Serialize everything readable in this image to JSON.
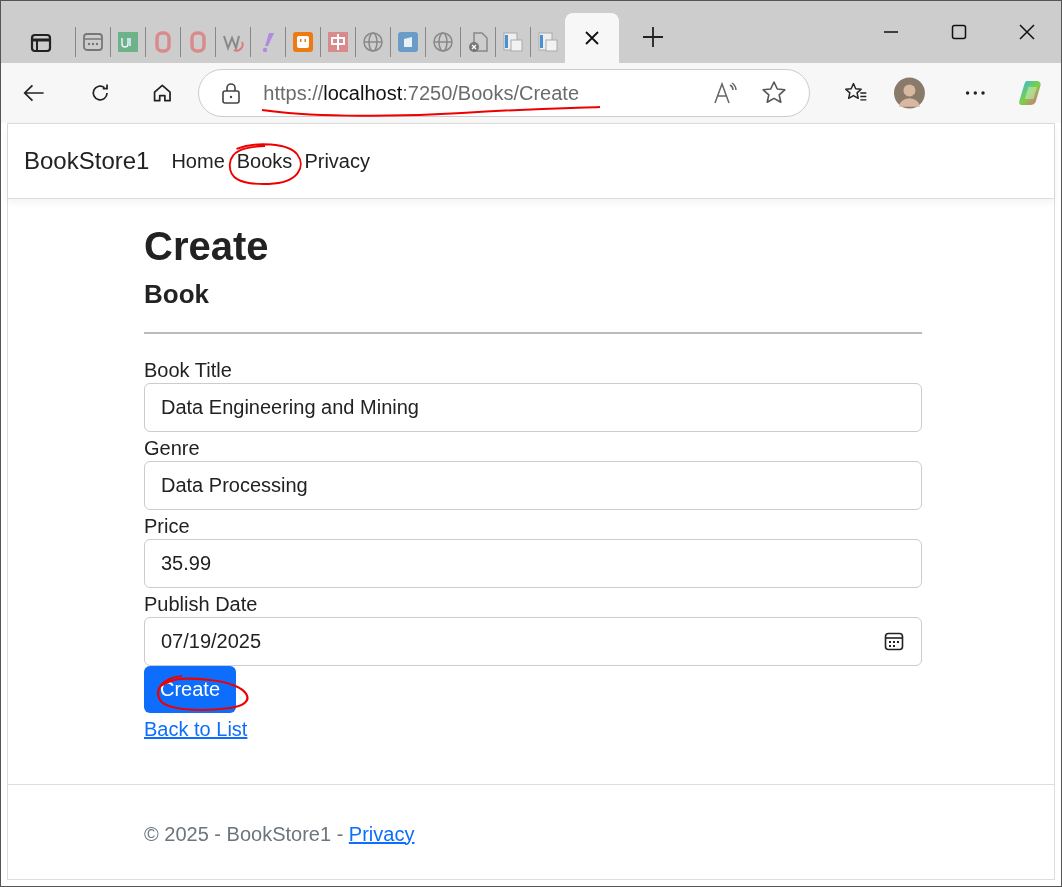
{
  "browser": {
    "tabs": [
      {
        "kind": "calendar",
        "selected": false
      },
      {
        "kind": "green",
        "selected": false
      },
      {
        "kind": "ring",
        "selected": false
      },
      {
        "kind": "ring",
        "selected": false
      },
      {
        "kind": "wave",
        "selected": false
      },
      {
        "kind": "exclaim",
        "selected": false
      },
      {
        "kind": "plug",
        "selected": false
      },
      {
        "kind": "redsquare",
        "selected": false
      },
      {
        "kind": "globe",
        "selected": false
      },
      {
        "kind": "bluedoc",
        "selected": false
      },
      {
        "kind": "globe",
        "selected": false
      },
      {
        "kind": "fileerror",
        "selected": false
      },
      {
        "kind": "pages",
        "selected": false
      },
      {
        "kind": "pages",
        "selected": false
      },
      {
        "kind": "blank",
        "selected": true
      }
    ],
    "address": {
      "scheme": "https://",
      "host": "localhost",
      "rest": ":7250/Books/Create"
    }
  },
  "navbar": {
    "brand": "BookStore1",
    "links": [
      {
        "label": "Home",
        "circled": false
      },
      {
        "label": "Books",
        "circled": true
      },
      {
        "label": "Privacy",
        "circled": false
      }
    ]
  },
  "page": {
    "title": "Create",
    "subtitle": "Book",
    "fields": [
      {
        "label": "Book Title",
        "value": "Data Engineering and Mining",
        "kind": "text"
      },
      {
        "label": "Genre",
        "value": "Data Processing",
        "kind": "text"
      },
      {
        "label": "Price",
        "value": "35.99",
        "kind": "text"
      },
      {
        "label": "Publish Date",
        "value": "07/19/2025",
        "kind": "date"
      }
    ],
    "submit": {
      "label": "Create",
      "circled": true
    },
    "back_link": "Back to List"
  },
  "footer": {
    "text": "© 2025 - BookStore1 - ",
    "link": "Privacy"
  }
}
